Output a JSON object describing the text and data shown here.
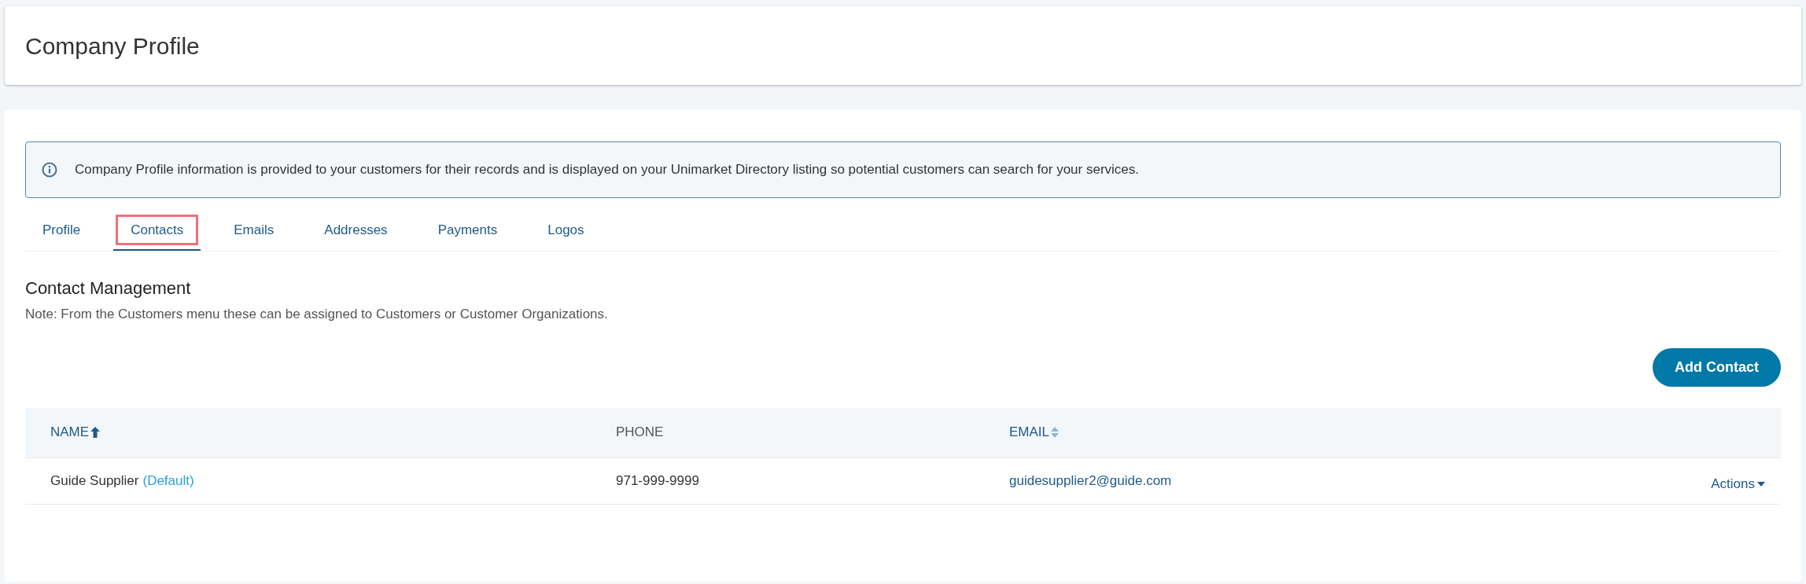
{
  "header": {
    "title": "Company Profile"
  },
  "info_banner": {
    "text": "Company Profile information is provided to your customers for their records and is displayed on your Unimarket Directory listing so potential customers can search for your services."
  },
  "tabs": [
    {
      "label": "Profile",
      "selected": false,
      "outlined": false
    },
    {
      "label": "Contacts",
      "selected": true,
      "outlined": true
    },
    {
      "label": "Emails",
      "selected": false,
      "outlined": false
    },
    {
      "label": "Addresses",
      "selected": false,
      "outlined": false
    },
    {
      "label": "Payments",
      "selected": false,
      "outlined": false
    },
    {
      "label": "Logos",
      "selected": false,
      "outlined": false
    }
  ],
  "section": {
    "title": "Contact Management",
    "note": "Note: From the Customers menu these can be assigned to Customers or Customer Organizations."
  },
  "add_button": "Add Contact",
  "table": {
    "columns": [
      {
        "label": "NAME",
        "kind": "sorted"
      },
      {
        "label": "PHONE",
        "kind": "plain"
      },
      {
        "label": "EMAIL",
        "kind": "sortable"
      }
    ],
    "rows": [
      {
        "name": "Guide Supplier",
        "tag": "(Default)",
        "phone": "971-999-9999",
        "email": "guidesupplier2@guide.com",
        "actions": "Actions"
      }
    ]
  }
}
